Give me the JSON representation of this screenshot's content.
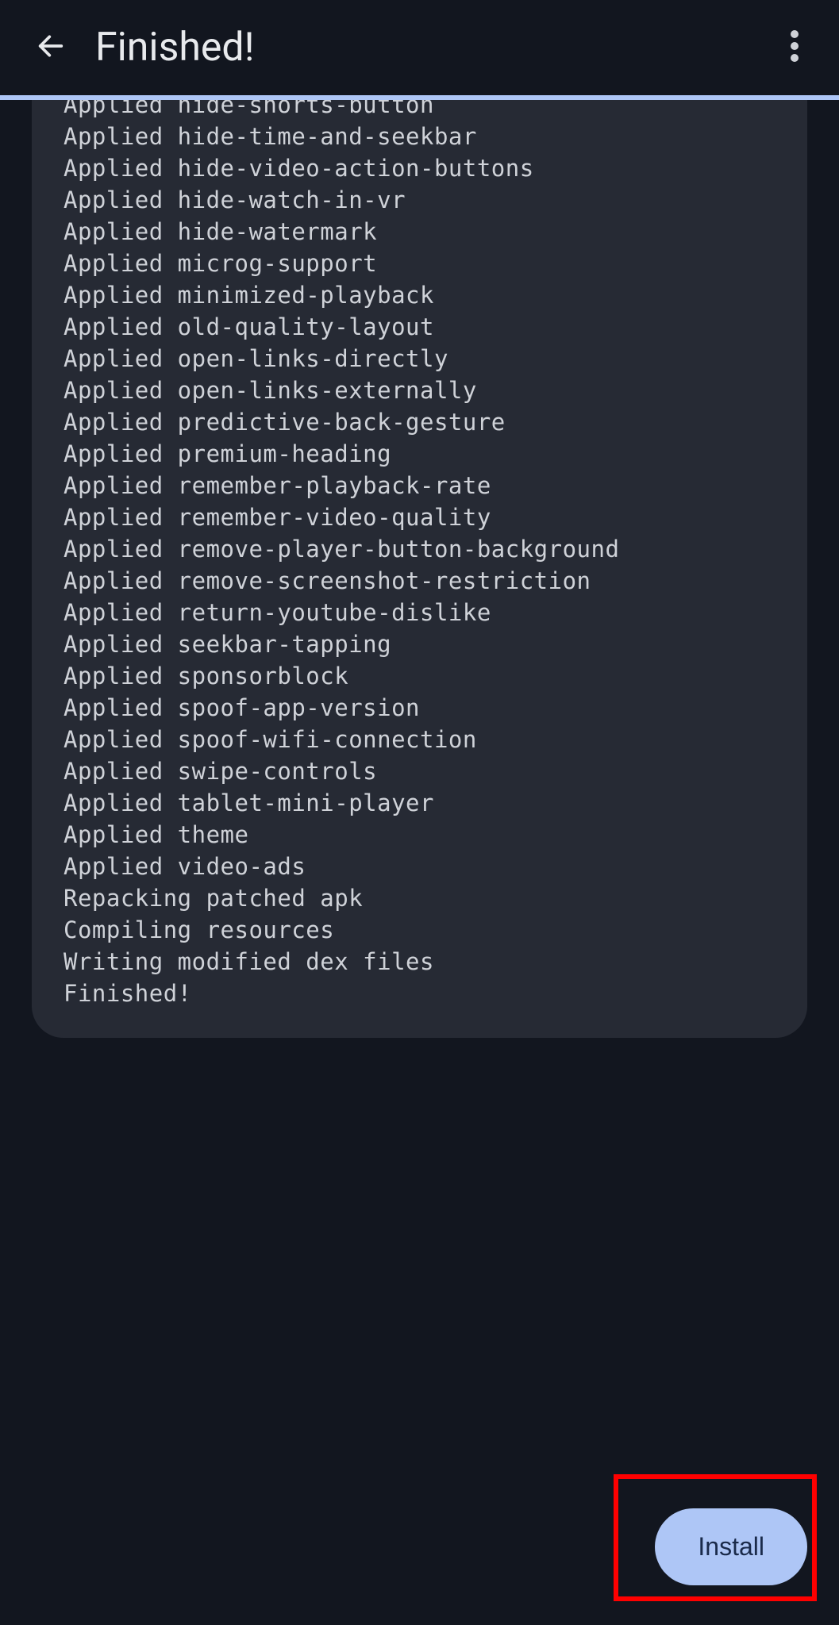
{
  "header": {
    "title": "Finished!"
  },
  "log_lines": [
    "Applied hide-shorts-button",
    "Applied hide-time-and-seekbar",
    "Applied hide-video-action-buttons",
    "Applied hide-watch-in-vr",
    "Applied hide-watermark",
    "Applied microg-support",
    "Applied minimized-playback",
    "Applied old-quality-layout",
    "Applied open-links-directly",
    "Applied open-links-externally",
    "Applied predictive-back-gesture",
    "Applied premium-heading",
    "Applied remember-playback-rate",
    "Applied remember-video-quality",
    "Applied remove-player-button-background",
    "Applied remove-screenshot-restriction",
    "Applied return-youtube-dislike",
    "Applied seekbar-tapping",
    "Applied sponsorblock",
    "Applied spoof-app-version",
    "Applied spoof-wifi-connection",
    "Applied swipe-controls",
    "Applied tablet-mini-player",
    "Applied theme",
    "Applied video-ads",
    "Repacking patched apk",
    "Compiling resources",
    "Writing modified dex files",
    "Finished!"
  ],
  "footer": {
    "install_label": "Install"
  },
  "colors": {
    "accent": "#aec6f6",
    "bg": "#12161f",
    "card": "#262a34",
    "highlight": "#ff0000"
  }
}
